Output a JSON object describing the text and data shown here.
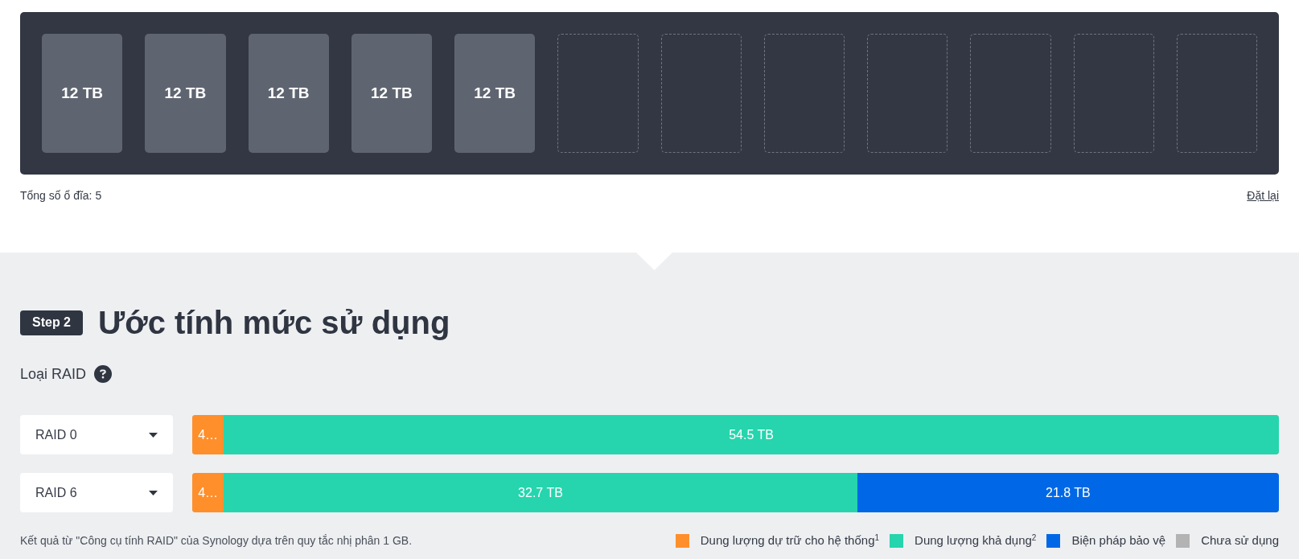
{
  "drive_bays": {
    "bays": [
      {
        "occupied": true,
        "label": "12 TB"
      },
      {
        "occupied": true,
        "label": "12 TB"
      },
      {
        "occupied": true,
        "label": "12 TB"
      },
      {
        "occupied": true,
        "label": "12 TB"
      },
      {
        "occupied": true,
        "label": "12 TB"
      },
      {
        "occupied": false
      },
      {
        "occupied": false
      },
      {
        "occupied": false
      },
      {
        "occupied": false
      },
      {
        "occupied": false
      },
      {
        "occupied": false
      },
      {
        "occupied": false
      }
    ]
  },
  "drive_summary": {
    "total": "Tổng số ổ đĩa: 5",
    "reset_link": "Đặt lại"
  },
  "step": {
    "badge": "Step 2",
    "title": "Ước tính mức sử dụng"
  },
  "raid_type": {
    "label": "Loại RAID"
  },
  "raid_rows": [
    {
      "select": {
        "value": "RAID 0"
      },
      "segments": [
        {
          "kind": "reserved",
          "label": "4…",
          "level": 0.029,
          "color": "#ff8f2b"
        },
        {
          "kind": "usable",
          "label": "54.5 TB",
          "color": "#26d5ad"
        }
      ]
    },
    {
      "select": {
        "value": "RAID 6"
      },
      "segments": [
        {
          "kind": "reserved",
          "label": "4…",
          "level": 0.029,
          "color": "#ff8f2b"
        },
        {
          "kind": "usable",
          "label": "32.7 TB",
          "color": "#26d5ad"
        },
        {
          "kind": "protection",
          "label": "21.8 TB",
          "level": 0.388,
          "color": "#0068e6"
        }
      ]
    }
  ],
  "footnote": "Kết quả từ \"Công cụ tính RAID\" của Synology dựa trên quy tắc nhị phân 1 GB.",
  "legend": [
    {
      "label": "Dung lượng dự trữ cho hệ thống$^{1}$",
      "color": "#ff8f2b"
    },
    {
      "label": "Dung lượng khả dụng$^{2}$",
      "color": "#26d5ad"
    },
    {
      "label": "Biện pháp bảo vệ",
      "color": "#0068e6"
    },
    {
      "label": "Chưa sử dụng",
      "color": "#b3b3b3"
    }
  ]
}
